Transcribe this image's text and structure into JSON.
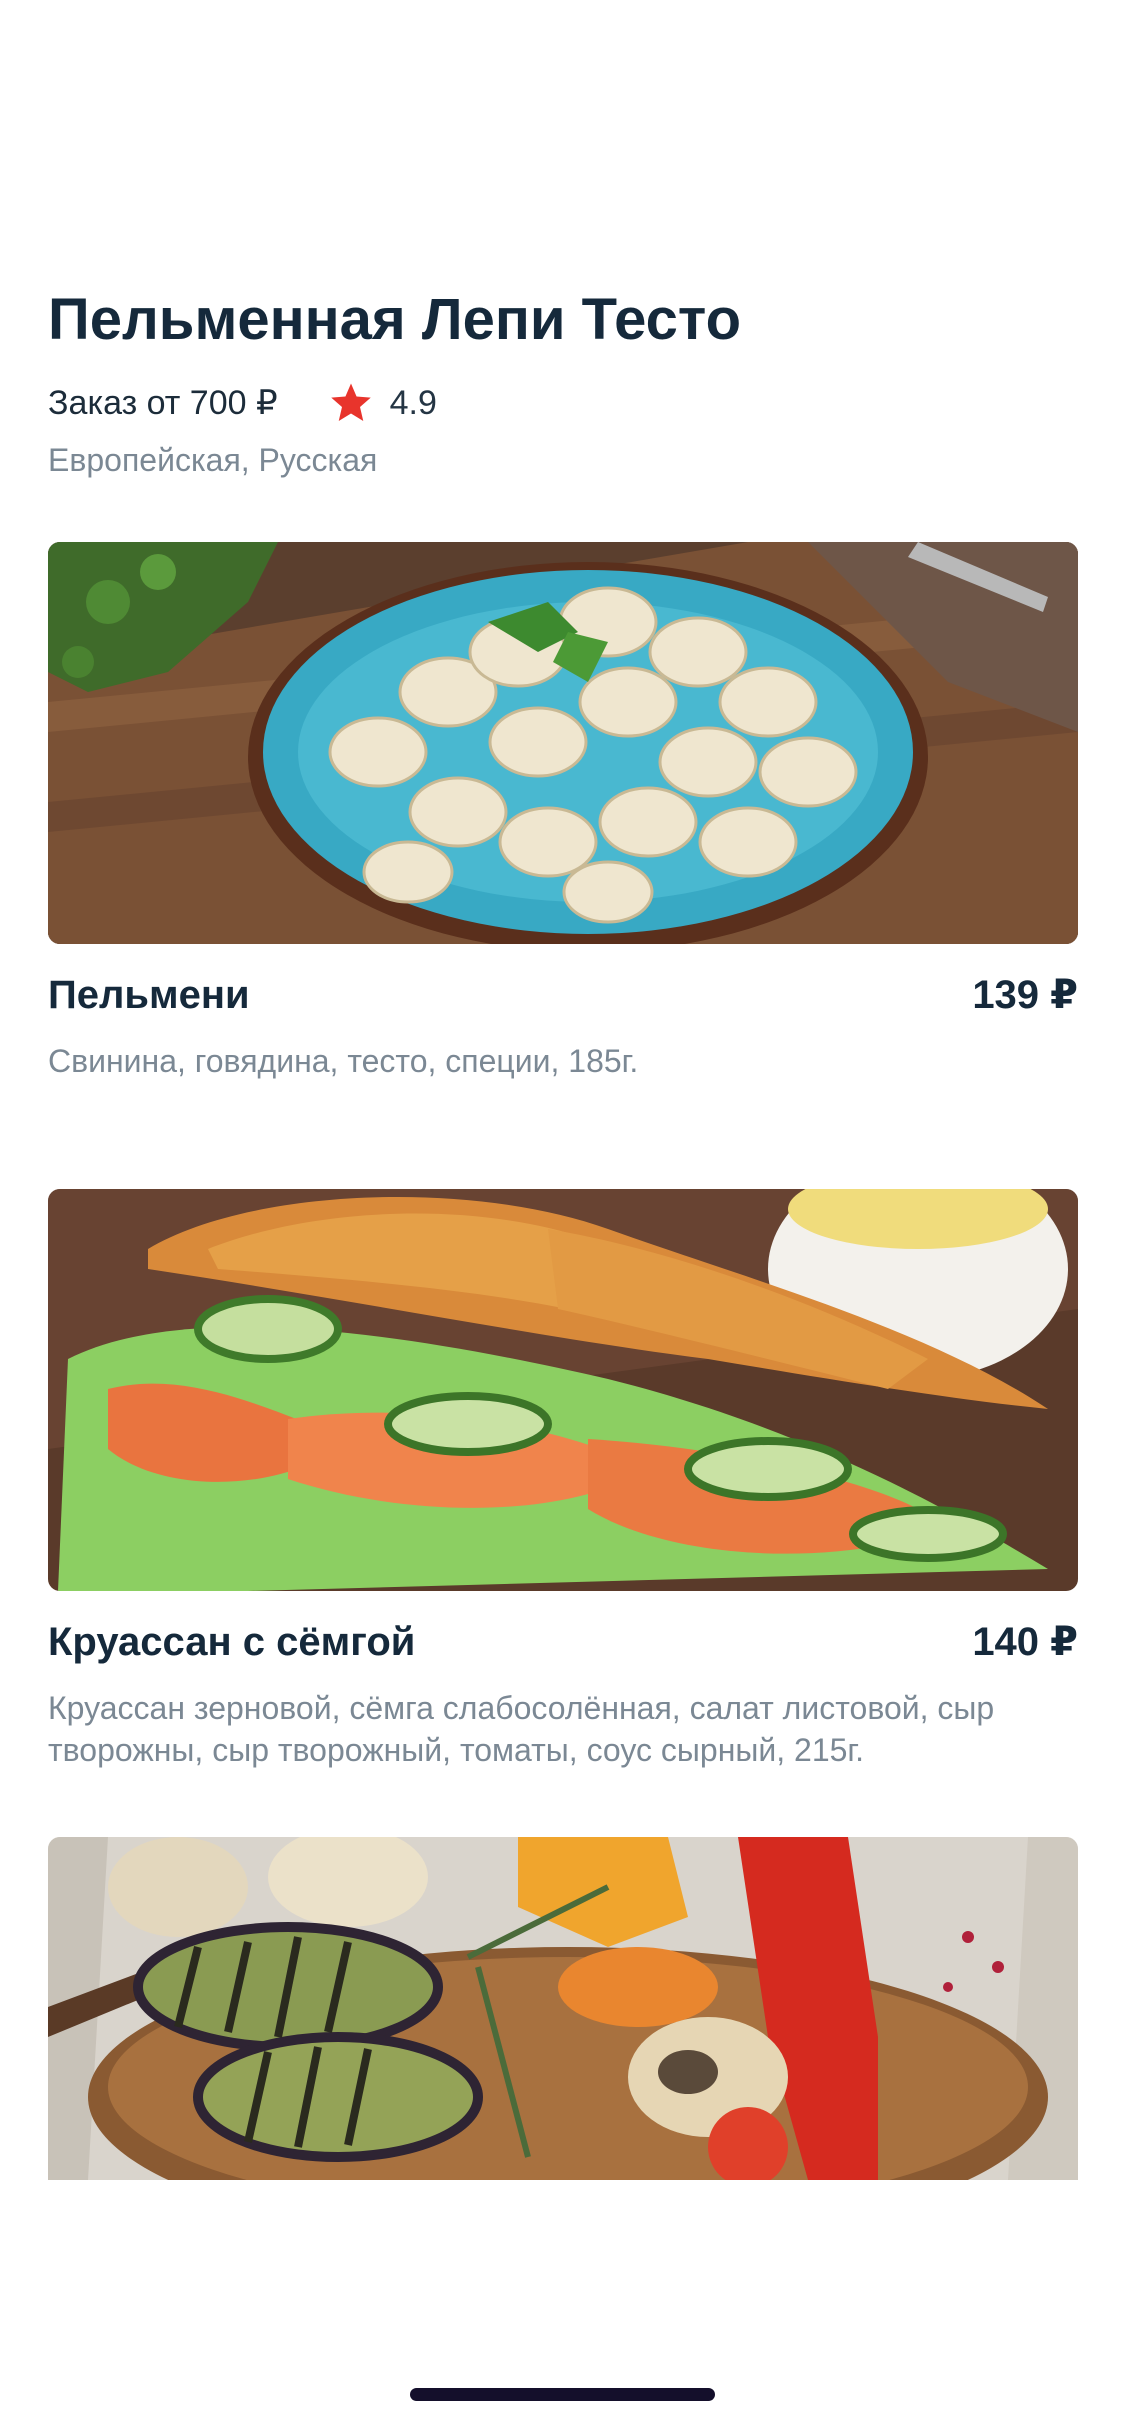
{
  "restaurant": {
    "name": "Пельменная Лепи Тесто",
    "min_order": "Заказ от 700 ₽",
    "rating": "4.9",
    "cuisine": "Европейская, Русская"
  },
  "dishes": [
    {
      "name": "Пельмени",
      "price": "139 ₽",
      "description": "Свинина, говядина, тесто, специи, 185г."
    },
    {
      "name": "Круассан с сёмгой",
      "price": "140 ₽",
      "description": "Круассан зерновой, сёмга слабосолённая, салат листовой, сыр творожны, сыр творожный, томаты, соус сырный, 215г."
    },
    {
      "name": "",
      "price": "",
      "description": ""
    }
  ],
  "colors": {
    "title": "#15293b",
    "muted": "#7b8894",
    "star": "#e8342c",
    "home_indicator": "#140f2b"
  },
  "icons": {
    "rating": "star-icon"
  }
}
